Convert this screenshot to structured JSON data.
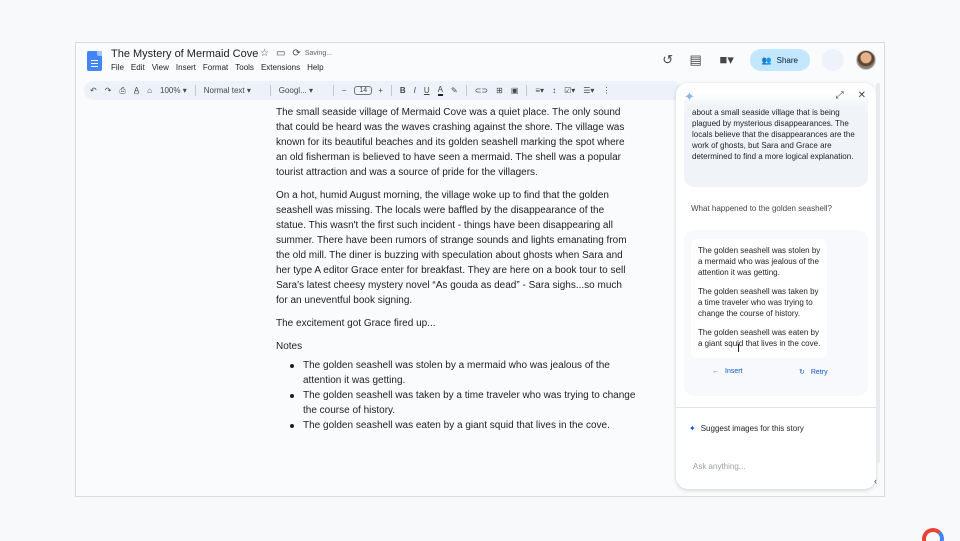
{
  "doc": {
    "title": "The Mystery of Mermaid Cove",
    "status": "Saving...",
    "menu": [
      "File",
      "Edit",
      "View",
      "Insert",
      "Format",
      "Tools",
      "Extensions",
      "Help"
    ]
  },
  "header": {
    "share_label": "Share"
  },
  "toolbar": {
    "zoom": "100%",
    "style": "Normal text",
    "font": "Googl...",
    "font_size": "14"
  },
  "body": {
    "p1": "The small seaside village of Mermaid Cove was a quiet place. The only sound that could be heard was the waves crashing against the shore. The village was known for its beautiful beaches and its golden seashell marking the spot where an old fisherman is believed to have seen a mermaid. The shell was a popular tourist attraction and was a source of pride for the villagers.",
    "p2": "On a hot, humid August morning, the village woke up to find that the golden seashell was missing. The locals were baffled by the disappearance of the statue. This wasn't the first such incident - things have been disappearing all summer. There have been rumors of strange sounds and lights emanating from the old mill. The diner is buzzing with speculation about ghosts when Sara and her type A editor Grace enter for breakfast. They are here on a book tour to sell Sara's latest cheesy mystery novel “As gouda as dead” - Sara sighs...so much for an uneventful book signing.",
    "p3": "The excitement got Grace fired up...",
    "notes_heading": "Notes",
    "notes": [
      "The golden seashell was stolen by a mermaid who was jealous of the attention it was getting.",
      "The golden seashell was taken by a time traveler who was trying to change the course of history.",
      "The golden seashell was eaten by a giant squid that lives in the cove."
    ]
  },
  "panel": {
    "summary": "about a small seaside village that is being plagued by mysterious disappearances. The locals believe that the disappearances are the work of ghosts, but Sara and Grace are determined to find a more logical explanation.",
    "question": "What happened to the golden seashell?",
    "results": [
      "The golden seashell was stolen by a mermaid who was jealous of the attention it was getting.",
      "The golden seashell was taken by a time traveler who was trying to change the course of history.",
      "The golden seashell was eaten by a giant squid that lives in the cove."
    ],
    "insert_label": "Insert",
    "retry_label": "Retry",
    "suggest_label": "Suggest images for this story",
    "ask_placeholder": "Ask anything..."
  }
}
